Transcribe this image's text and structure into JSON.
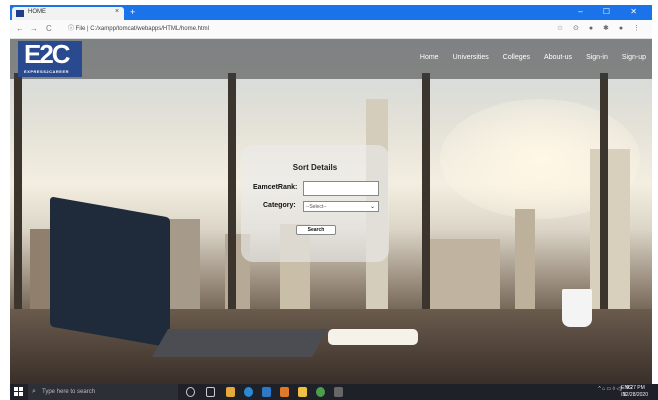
{
  "browser": {
    "tab_title": "HOME",
    "tab_close": "×",
    "new_tab": "+",
    "window_controls": "– ☐ ✕",
    "nav_back": "←",
    "nav_forward": "→",
    "nav_reload": "C",
    "address": "ⓘ File | C:/xampp/tomcat/webapps/HTML/home.html",
    "extensions": "☆ ⊙ ● ✱ ● ⋮"
  },
  "site": {
    "logo_big": "E2C",
    "logo_small": "EXPRESS2CAREER",
    "nav": [
      "Home",
      "Universities",
      "Colleges",
      "About-us",
      "Sign-in",
      "Sign-up"
    ]
  },
  "form": {
    "title": "Sort Details",
    "rank_label": "EamcetRank:",
    "rank_value": "",
    "category_label": "Category:",
    "category_selected": "--Select--",
    "search_button": "Search"
  },
  "taskbar": {
    "search_placeholder": "Type here to search",
    "tray": "^ ⌂ ▭ ◊ ◁)",
    "lang_top": "ENG",
    "lang_bottom": "IN",
    "time": "9:27 PM",
    "date": "12/28/2020"
  }
}
